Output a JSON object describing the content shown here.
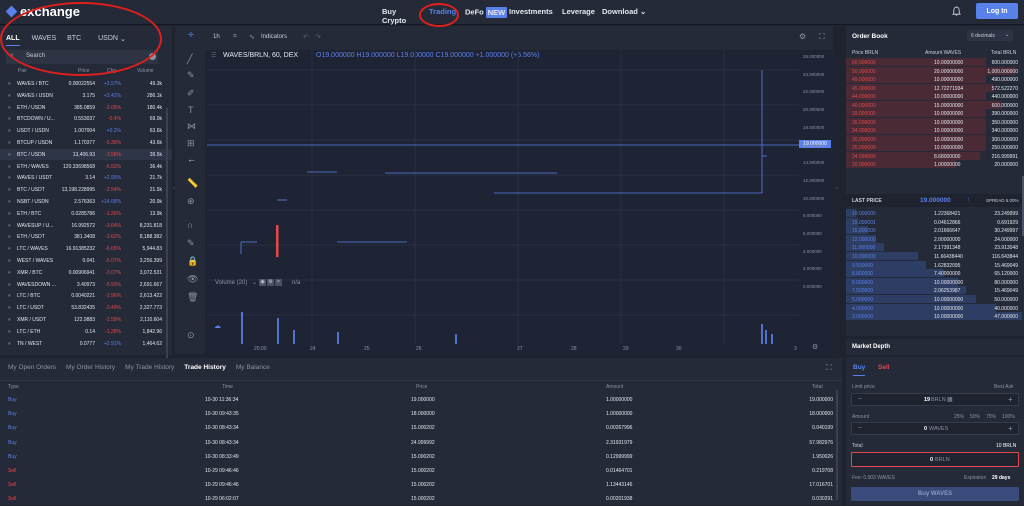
{
  "brand": {
    "name": "exchange"
  },
  "nav": [
    {
      "label": "Buy Crypto"
    },
    {
      "label": "Trading"
    },
    {
      "label": "DeFo",
      "badge": "NEW"
    },
    {
      "label": "Investments"
    },
    {
      "label": "Leverage"
    },
    {
      "label": "Download"
    }
  ],
  "login_label": "Log In",
  "markets": {
    "tabs": [
      "ALL",
      "WAVES",
      "BTC",
      "USDN"
    ],
    "search_label": "Search",
    "cols": {
      "pair": "Pair",
      "price": "Price",
      "chg": "Chg",
      "volume": "Volume"
    },
    "rows": [
      {
        "pair": "WAVES / BTC",
        "price": "0.00022554",
        "chg": "+3.57%",
        "vol": "49.3k",
        "up": true
      },
      {
        "pair": "WAVES / USDN",
        "price": "3.175",
        "chg": "+3.42%",
        "vol": "286.1k",
        "up": true
      },
      {
        "pair": "ETH / USDN",
        "price": "385.0859",
        "chg": "-2.05%",
        "vol": "180.4k",
        "up": false
      },
      {
        "pair": "BTCDOWN / U...",
        "price": "0.553037",
        "chg": "-0.4%",
        "vol": "69.0k",
        "up": false
      },
      {
        "pair": "USDT / USDN",
        "price": "1.007004",
        "chg": "+0.2%",
        "vol": "63.6k",
        "up": true
      },
      {
        "pair": "BTCUP / USDN",
        "price": "1.170377",
        "chg": "-5.39%",
        "vol": "43.6k",
        "up": false
      },
      {
        "pair": "BTC / USDN",
        "price": "13,406.93",
        "chg": "-3.58%",
        "vol": "39.5k",
        "up": false
      },
      {
        "pair": "ETH / WAVES",
        "price": "120.33698568",
        "chg": "-6.52%",
        "vol": "36.4k",
        "up": false
      },
      {
        "pair": "WAVES / USDT",
        "price": "3.14",
        "chg": "+2.95%",
        "vol": "21.7k",
        "up": true
      },
      {
        "pair": "BTC / USDT",
        "price": "13,198.228995",
        "chg": "-2.54%",
        "vol": "21.5k",
        "up": false
      },
      {
        "pair": "NSBT / USDN",
        "price": "2.576363",
        "chg": "+14.68%",
        "vol": "20.9k",
        "up": true
      },
      {
        "pair": "ETH / BTC",
        "price": "0.0285786",
        "chg": "-1.26%",
        "vol": "13.9k",
        "up": false
      },
      {
        "pair": "WAVESUP / U...",
        "price": "16.992572",
        "chg": "-3.64%",
        "vol": "8,231.818",
        "up": false
      },
      {
        "pair": "ETH / USDT",
        "price": "381.3408",
        "chg": "-2.62%",
        "vol": "8,188.382",
        "up": false
      },
      {
        "pair": "LTC / WAVES",
        "price": "16.91385232",
        "chg": "-6.65%",
        "vol": "5,944.83",
        "up": false
      },
      {
        "pair": "WEST / WAVES",
        "price": "0.041",
        "chg": "-5.07%",
        "vol": "3,256.399",
        "up": false
      },
      {
        "pair": "XMR / BTC",
        "price": "0.00906941",
        "chg": "-3.07%",
        "vol": "3,072.531",
        "up": false
      },
      {
        "pair": "WAVESDOWN ...",
        "price": "3.40973",
        "chg": "-5.93%",
        "vol": "2,691.667",
        "up": false
      },
      {
        "pair": "LTC / BTC",
        "price": "0.0040221",
        "chg": "-2.96%",
        "vol": "2,613.422",
        "up": false
      },
      {
        "pair": "LTC / USDT",
        "price": "53.832435",
        "chg": "-2.49%",
        "vol": "2,327.773",
        "up": false
      },
      {
        "pair": "XMR / USDT",
        "price": "122.9883",
        "chg": "-2.59%",
        "vol": "2,110.604",
        "up": false
      },
      {
        "pair": "LTC / ETH",
        "price": "0.14",
        "chg": "-1.28%",
        "vol": "1,842.96",
        "up": false
      },
      {
        "pair": "TN / WEST",
        "price": "0.0777",
        "chg": "+2.91%",
        "vol": "1,464.62",
        "up": true
      }
    ]
  },
  "chart": {
    "interval": "1h",
    "indicators_label": "Indicators",
    "symbol": "WAVES/BRLN, 60, DEX",
    "ohlc": "O19.000000  H19.000000  L19.000000  C19.000000  +1.000000 (+5.56%)",
    "price_tag": "19.000000",
    "volume_label": "Volume (20)",
    "volume_value": "n/a",
    "y_ticks": [
      "26.000000",
      "24.000000",
      "22.000000",
      "20.000000",
      "18.000000",
      "16.000000",
      "14.000000",
      "12.000000",
      "10.000000",
      "8.000000",
      "6.000000",
      "4.000000",
      "2.000000",
      "0.000000"
    ],
    "x_ticks": [
      "20:00",
      "24",
      "25",
      "26",
      "27",
      "28",
      "29",
      "30",
      "3"
    ]
  },
  "bottom": {
    "tabs": [
      "My Open Orders",
      "My Order History",
      "My Trade History",
      "Trade History",
      "My Balance"
    ],
    "active_tab": 3,
    "cols": {
      "type": "Type",
      "time": "Time",
      "price": "Price",
      "amount": "Amount",
      "total": "Total"
    },
    "rows": [
      {
        "type": "Buy",
        "time": "10-30 11:36:34",
        "price": "19.000000",
        "amount": "1.00000000",
        "total": "19.000000"
      },
      {
        "type": "Buy",
        "time": "10-30 09:43:35",
        "price": "18.000000",
        "amount": "1.00000000",
        "total": "18.000000"
      },
      {
        "type": "Buy",
        "time": "10-30 08:43:34",
        "price": "15.000202",
        "amount": "0.00267996",
        "total": "0.040199"
      },
      {
        "type": "Buy",
        "time": "10-30 08:43:34",
        "price": "24.999992",
        "amount": "2.31931979",
        "total": "57.982976"
      },
      {
        "type": "Buy",
        "time": "10-30 08:33:49",
        "price": "15.000202",
        "amount": "0.12999999",
        "total": "1.950026"
      },
      {
        "type": "Sell",
        "time": "10-29 09:46:46",
        "price": "15.000202",
        "amount": "0.01464701",
        "total": "0.219708"
      },
      {
        "type": "Sell",
        "time": "10-29 09:46:46",
        "price": "15.000202",
        "amount": "1.13443146",
        "total": "17.016701"
      },
      {
        "type": "Sell",
        "time": "10-29 06:02:07",
        "price": "15.000202",
        "amount": "0.00201938",
        "total": "0.030291"
      }
    ]
  },
  "orderbook": {
    "title": "Order Book",
    "decimals": "6 decimals",
    "cols": {
      "price": "Price BRLN",
      "amount": "Amount WAVES",
      "total": "Total BRLN"
    },
    "asks": [
      {
        "p": "60.000000",
        "a": "10.00000000",
        "t": "600.000000"
      },
      {
        "p": "50.000000",
        "a": "20.00000000",
        "t": "1,000.000000"
      },
      {
        "p": "49.000000",
        "a": "10.00000000",
        "t": "490.000000"
      },
      {
        "p": "45.000000",
        "a": "12.72271934",
        "t": "572.522270"
      },
      {
        "p": "44.000000",
        "a": "10.00000000",
        "t": "440.000000"
      },
      {
        "p": "40.000000",
        "a": "15.00000000",
        "t": "600.000000"
      },
      {
        "p": "39.000000",
        "a": "10.00000000",
        "t": "390.000000"
      },
      {
        "p": "35.000000",
        "a": "10.00000000",
        "t": "350.000000"
      },
      {
        "p": "34.000000",
        "a": "10.00000000",
        "t": "340.000000"
      },
      {
        "p": "30.000000",
        "a": "10.00000000",
        "t": "300.000000"
      },
      {
        "p": "25.000000",
        "a": "10.00000000",
        "t": "250.000000"
      },
      {
        "p": "24.999999",
        "a": "8.68000000",
        "t": "216.999991"
      },
      {
        "p": "20.000000",
        "a": "1.00000000",
        "t": "20.000000"
      }
    ],
    "last_label": "LAST PRICE",
    "last_price": "19.000000",
    "spread_label": "SPREAD 5.00%",
    "bids": [
      {
        "p": "19.000000",
        "a": "1.22368421",
        "t": "23.249999"
      },
      {
        "p": "15.000001",
        "a": "0.04612866",
        "t": "0.691929"
      },
      {
        "p": "15.000000",
        "a": "2.01666647",
        "t": "30.249997"
      },
      {
        "p": "12.000000",
        "a": "2.00000000",
        "t": "24.000000"
      },
      {
        "p": "11.000000",
        "a": "2.17391348",
        "t": "23.913048"
      },
      {
        "p": "10.000000",
        "a": "11.66438440",
        "t": "116.643844"
      },
      {
        "p": "9.500000",
        "a": "1.62832095",
        "t": "15.469049"
      },
      {
        "p": "8.800000",
        "a": "7.40000000",
        "t": "65.120000"
      },
      {
        "p": "8.000000",
        "a": "10.00000000",
        "t": "80.000000"
      },
      {
        "p": "7.500000",
        "a": "2.06253987",
        "t": "15.469049"
      },
      {
        "p": "5.000000",
        "a": "10.00000000",
        "t": "50.000000"
      },
      {
        "p": "4.000000",
        "a": "10.00000000",
        "t": "40.000000"
      },
      {
        "p": "3.000000",
        "a": "10.00000000",
        "t": "47.000000"
      }
    ]
  },
  "depth_label": "Market Depth",
  "order": {
    "buy_label": "Buy",
    "sell_label": "Sell",
    "limit_label": "Limit price",
    "best_ask_label": "Best Ask",
    "price_value": "19",
    "price_unit": "BRLN",
    "amount_label": "Amount",
    "pcts": [
      "25%",
      "50%",
      "75%",
      "100%"
    ],
    "amount_value": "0",
    "amount_unit": "WAVES",
    "total_label": "Total",
    "total_value": "10 BRLN",
    "total_input": "0",
    "total_unit": "BRLN",
    "fee_label": "Fee: 0.003 WAVES",
    "expiration_label": "Expiration",
    "expiration_value": "29 days",
    "submit_label": "Buy WAVES"
  },
  "colors": {
    "accent": "#5a81ea",
    "up": "#5a81ea",
    "down": "#e5484d"
  }
}
